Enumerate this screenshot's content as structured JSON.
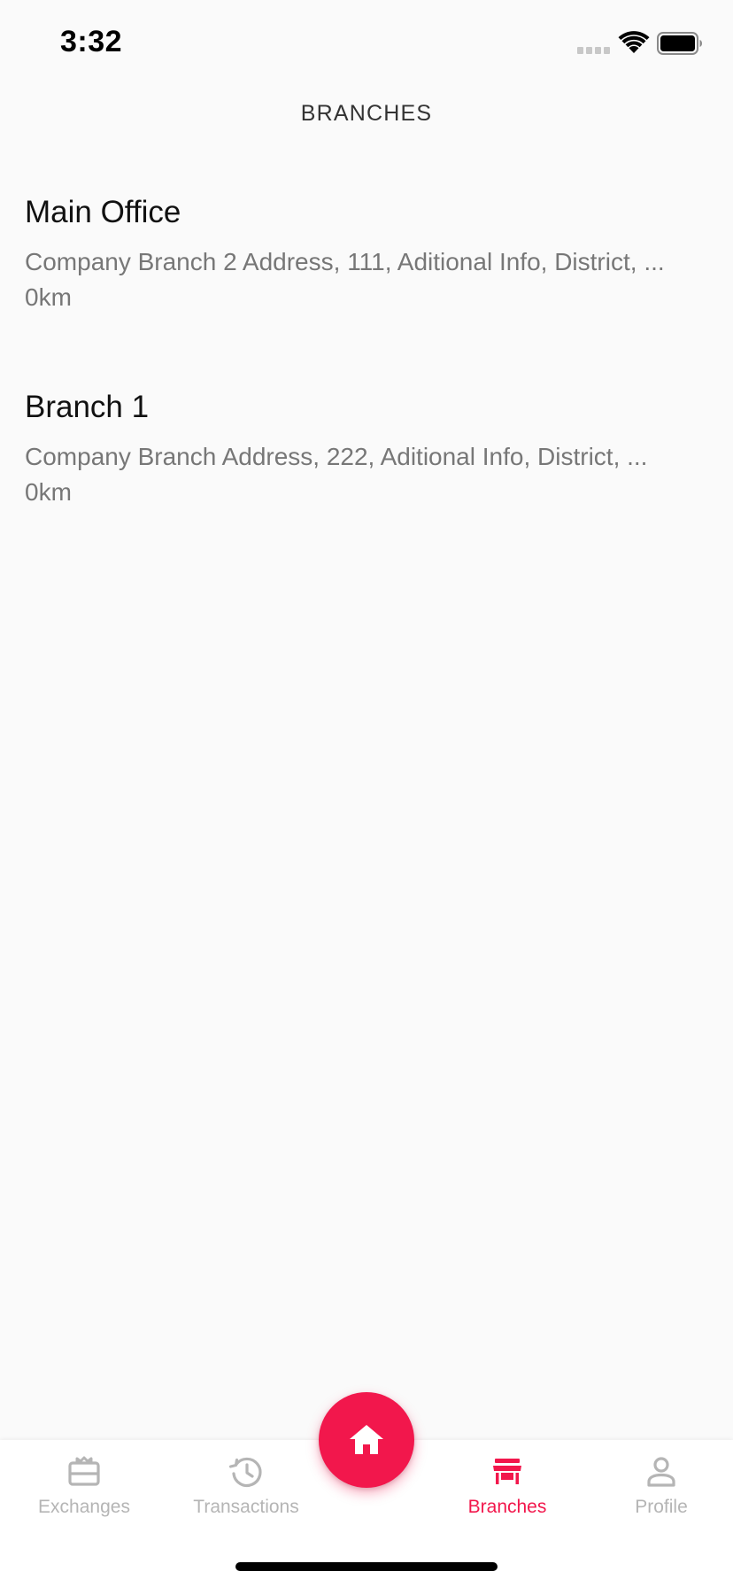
{
  "status_bar": {
    "time": "3:32"
  },
  "header": {
    "title": "BRANCHES"
  },
  "branches": [
    {
      "name": "Main Office",
      "address": "Company Branch 2 Address, 111, Aditional Info, District, ...",
      "distance": "0km"
    },
    {
      "name": "Branch 1",
      "address": "Company Branch Address, 222, Aditional Info, District, ...",
      "distance": "0km"
    }
  ],
  "tab_bar": {
    "items": [
      {
        "label": "Exchanges",
        "icon": "exchange-box-icon",
        "active": false
      },
      {
        "label": "Transactions",
        "icon": "history-clock-icon",
        "active": false
      },
      {
        "label": "Branches",
        "icon": "store-icon",
        "active": true
      },
      {
        "label": "Profile",
        "icon": "person-icon",
        "active": false
      }
    ],
    "fab_icon": "home-icon"
  },
  "colors": {
    "accent": "#f2174c",
    "inactive": "#b5b5b5",
    "background": "#fafafa"
  }
}
